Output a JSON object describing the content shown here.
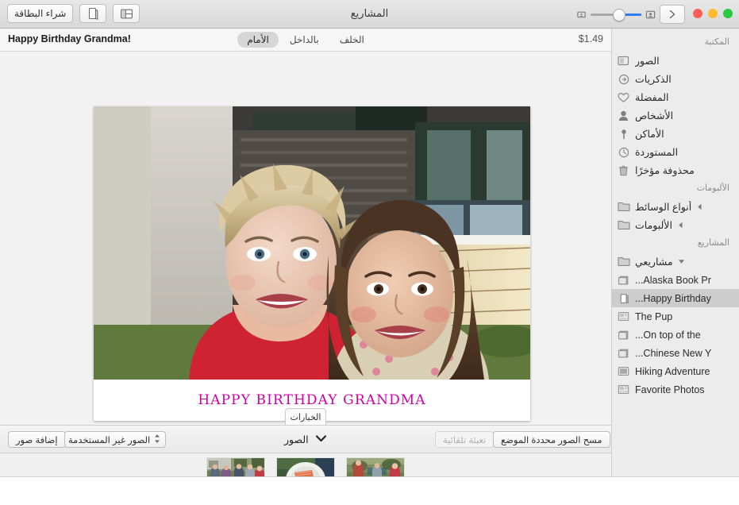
{
  "window": {
    "title": "المشاريع",
    "traffic_lights": [
      "close",
      "minimize",
      "maximize"
    ]
  },
  "toolbar": {
    "buy_card_label": "شراء البطاقة",
    "card_icon": "card-page-icon",
    "layout_icon": "layout-panel-icon",
    "zoom_small_icon": "small-thumbnail-icon",
    "zoom_large_icon": "large-thumbnail-icon",
    "zoom_value": 67,
    "next_icon": "chevron-forward-icon",
    "accent_color": "#2f7cf6"
  },
  "subbar": {
    "project_name": "Happy Birthday Grandma!",
    "price": "$1.49",
    "segments": [
      {
        "label": "الأمام",
        "active": true
      },
      {
        "label": "بالداخل",
        "active": false
      },
      {
        "label": "الخلف",
        "active": false
      }
    ]
  },
  "card": {
    "caption": "HAPPY BIRTHDAY GRANDMA",
    "caption_color": "#cc00a6",
    "photo_alt": "grandmother-and-granddaughter-photo"
  },
  "options_tab": {
    "label": "الخيارات"
  },
  "bottombar": {
    "add_photos_label": "إضافة صور",
    "unused_photos_label": "الصور غير المستخدمة",
    "autofill_label": "تعبئة تلقائية",
    "clear_placed_label": "مسح الصور محددة الموضع",
    "photos_popup_label": "الصور"
  },
  "sidebar": {
    "sections": [
      {
        "header": "المكتبة",
        "items": [
          {
            "label": "الصور",
            "icon": "photos-icon"
          },
          {
            "label": "الذكريات",
            "icon": "memories-icon"
          },
          {
            "label": "المفضلة",
            "icon": "heart-icon"
          },
          {
            "label": "الأشخاص",
            "icon": "person-icon"
          },
          {
            "label": "الأماكن",
            "icon": "pin-icon"
          },
          {
            "label": "المستوردة",
            "icon": "clock-icon"
          },
          {
            "label": "محذوفة مؤخرًا",
            "icon": "trash-icon"
          }
        ]
      },
      {
        "header": "الألبومات",
        "items": [
          {
            "label": "أنواع الوسائط",
            "icon": "folder-icon",
            "disclosure": "collapsed"
          },
          {
            "label": "الألبومات",
            "icon": "folder-icon",
            "disclosure": "collapsed"
          }
        ]
      },
      {
        "header": "المشاريع",
        "items": [
          {
            "label": "مشاريعي",
            "icon": "folder-icon",
            "disclosure": "expanded"
          }
        ]
      }
    ],
    "projects": [
      {
        "label": "Alaska Book Pr...",
        "icon": "book-project-icon",
        "selected": false
      },
      {
        "label": "Happy Birthday...",
        "icon": "card-project-icon",
        "selected": true
      },
      {
        "label": "The Pup",
        "icon": "slideshow-project-icon",
        "selected": false
      },
      {
        "label": "On top of the...",
        "icon": "book-project-icon",
        "selected": false
      },
      {
        "label": "Chinese New Y...",
        "icon": "book-project-icon",
        "selected": false
      },
      {
        "label": "Hiking Adventure",
        "icon": "print-project-icon",
        "selected": false
      },
      {
        "label": "Favorite Photos",
        "icon": "slideshow-project-icon",
        "selected": false
      }
    ]
  },
  "thumbnails": [
    {
      "name": "outdoor-dinner-table-photo"
    },
    {
      "name": "plated-salmon-dish-photo"
    },
    {
      "name": "family-gathering-photo"
    }
  ]
}
